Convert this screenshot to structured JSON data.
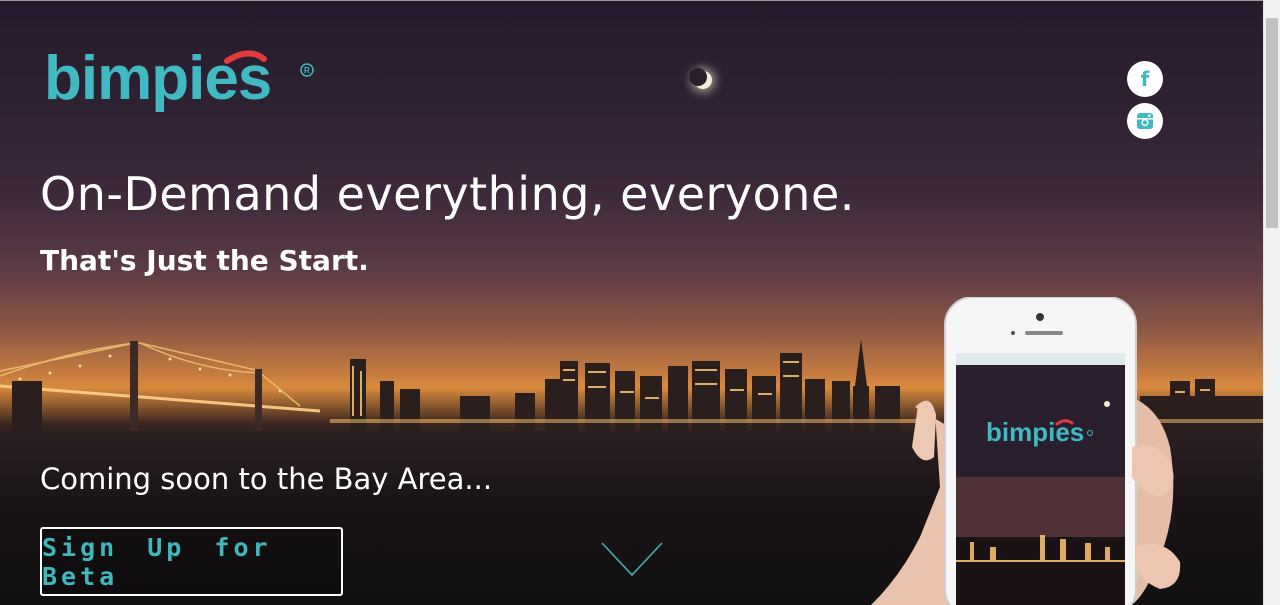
{
  "brand": {
    "name": "bimpies",
    "registered": "®",
    "accent": "#40b9c0",
    "mark_red": "#e13b3b"
  },
  "social": [
    {
      "name": "facebook",
      "icon": "facebook-icon",
      "glyph": "f"
    },
    {
      "name": "instagram",
      "icon": "instagram-icon"
    }
  ],
  "hero": {
    "headline": "On-Demand everything, everyone.",
    "subhead": "That's Just the Start.",
    "coming_soon": "Coming soon to the Bay Area...",
    "cta_label": "Sign Up for Beta"
  },
  "phone": {
    "app_name": "bimpies",
    "registered": "®"
  },
  "colors": {
    "text": "#ffffff",
    "cta_text": "#3fb8bd"
  },
  "icons": {
    "scroll_down": "chevron-down-icon"
  }
}
